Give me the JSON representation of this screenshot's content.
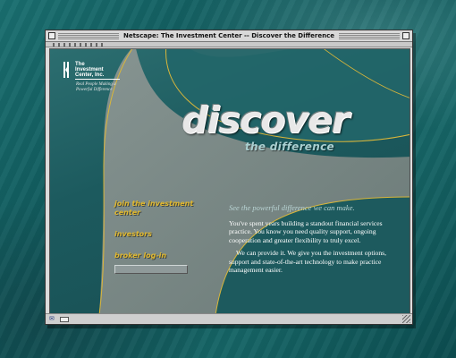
{
  "window": {
    "title": "Netscape: The Investment Center -- Discover the Difference"
  },
  "logo": {
    "line1": "The",
    "line2": "Investment",
    "line3": "Center, Inc.",
    "tagline": "Real People Making a Powerful Difference"
  },
  "hero": {
    "headline": "discover",
    "subhead": "the difference"
  },
  "nav": {
    "join_label": "join the investment center",
    "investors_label": "investors",
    "broker_label": "broker log-in",
    "login_value": ""
  },
  "copy": {
    "lead": "See the powerful difference we can make.",
    "para1": "You've spent years building a standout financial services practice. You know you need quality support, ongoing cooperation and greater flexibility to truly excel.",
    "para2": "We can provide it. We give you the investment options, support and state-of-the-art technology to make practice management easier."
  },
  "colors": {
    "accent": "#e1b82f",
    "page_bg": "#1c5a5e",
    "swoosh": "#7d8a87"
  }
}
